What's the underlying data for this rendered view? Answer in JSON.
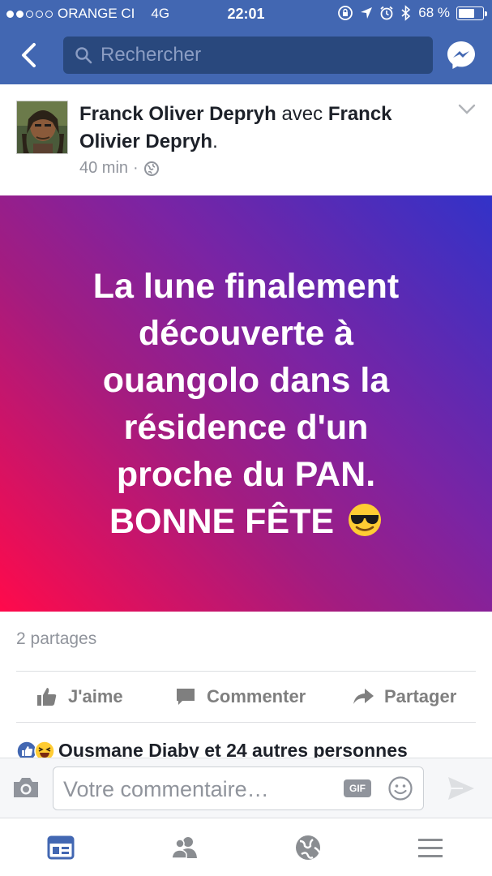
{
  "status_bar": {
    "carrier": "ORANGE CI",
    "network": "4G",
    "time": "22:01",
    "battery": "68 %",
    "battery_level": 0.68
  },
  "nav": {
    "search_placeholder": "Rechercher"
  },
  "post": {
    "author": "Franck Oliver Depryh",
    "with_word": "avec",
    "tagged": "Franck Olivier Depryh",
    "time": "40 min",
    "separator": "·",
    "status_lines": [
      "La lune finalement",
      "découverte à",
      "ouangolo dans la",
      "résidence d'un",
      "proche du PAN.",
      "BONNE FÊTE"
    ],
    "status_emoji": "smiling-face-with-sunglasses",
    "gradient_colors": [
      "#ff0a4b",
      "#a31c80",
      "#7a24a4",
      "#3232c8"
    ],
    "shares": "2 partages"
  },
  "actions": {
    "like": "J'aime",
    "comment": "Commenter",
    "share": "Partager"
  },
  "reactions": {
    "text": "Ousmane Diaby et 24 autres personnes"
  },
  "composer": {
    "placeholder": "Votre commentaire…",
    "gif": "GIF"
  },
  "colors": {
    "brand": "#4267b2",
    "search_bg": "#29487d",
    "tab_active": "#4267b2",
    "tab_inactive": "#8a8d91"
  }
}
